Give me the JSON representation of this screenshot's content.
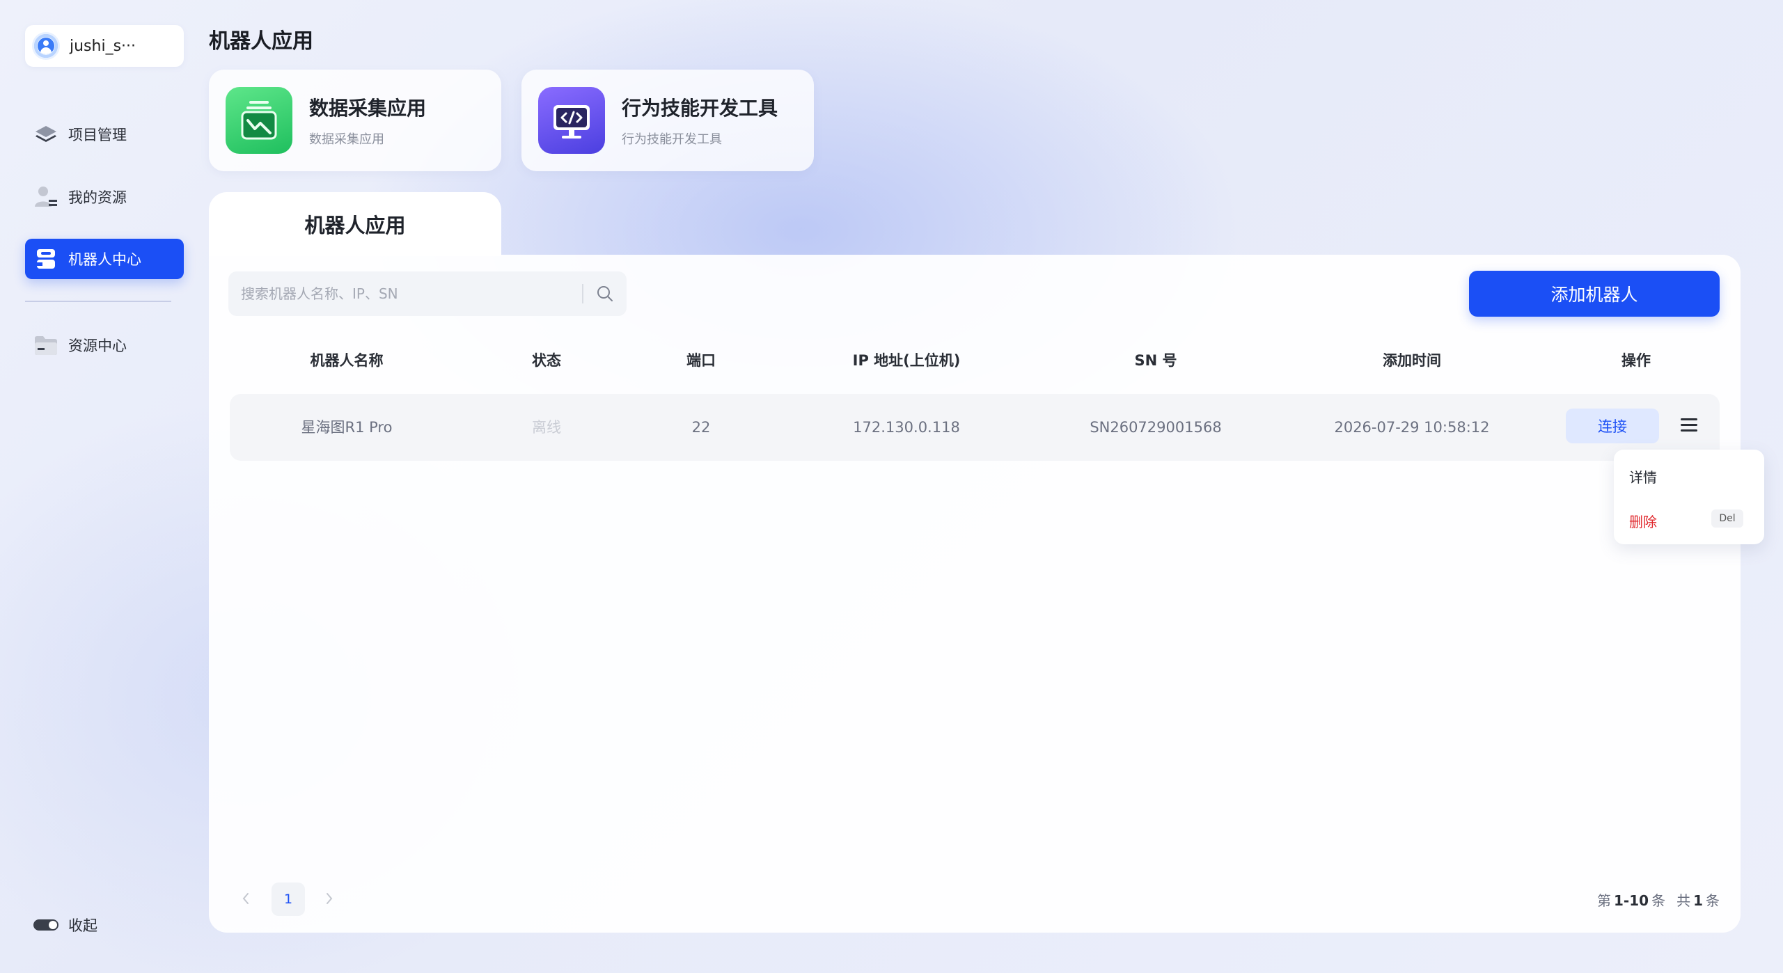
{
  "user": {
    "name": "jushi_s···"
  },
  "sidebar": {
    "items": [
      {
        "label": "项目管理",
        "icon": "layers-icon"
      },
      {
        "label": "我的资源",
        "icon": "user-resource-icon"
      },
      {
        "label": "机器人中心",
        "icon": "robot-icon",
        "active": true
      },
      {
        "label": "资源中心",
        "icon": "folder-icon"
      }
    ],
    "collapse_label": "收起"
  },
  "header": {
    "title": "机器人应用"
  },
  "apps": [
    {
      "title": "数据采集应用",
      "subtitle": "数据采集应用",
      "icon": "data-collection-icon",
      "color": "#2ecf6b"
    },
    {
      "title": "行为技能开发工具",
      "subtitle": "行为技能开发工具",
      "icon": "code-monitor-icon",
      "color": "#6b4cf5"
    }
  ],
  "tab": {
    "label": "机器人应用"
  },
  "search": {
    "placeholder": "搜索机器人名称、IP、SN",
    "value": ""
  },
  "actions": {
    "add_label": "添加机器人"
  },
  "table": {
    "columns": [
      "机器人名称",
      "状态",
      "端口",
      "IP 地址(上位机)",
      "SN 号",
      "添加时间",
      "操作"
    ],
    "rows": [
      {
        "name": "星海图R1 Pro",
        "status": "离线",
        "port": "22",
        "ip": "172.130.0.118",
        "sn": "SN260729001568",
        "added": "2026-07-29 10:58:12",
        "connect_label": "连接"
      }
    ]
  },
  "row_menu": {
    "items": [
      {
        "label": "详情"
      },
      {
        "label": "删除",
        "shortcut": "Del",
        "danger": true
      }
    ]
  },
  "pagination": {
    "current_page": "1",
    "range_prefix": "第",
    "range": "1-10",
    "range_suffix": "条",
    "total_prefix": "共",
    "total": "1",
    "total_suffix": "条"
  },
  "colors": {
    "primary": "#1b4ff5",
    "danger": "#e0262b",
    "offline": "#c9ccd4"
  }
}
